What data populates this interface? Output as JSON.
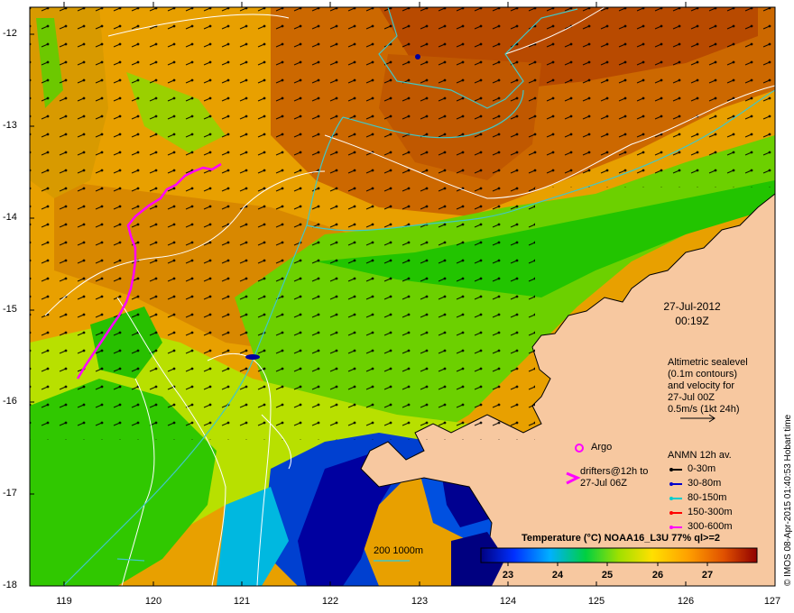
{
  "map": {
    "y_ticks": [
      "-12",
      "-13",
      "-14",
      "-15",
      "-16",
      "-17",
      "-18"
    ],
    "x_ticks": [
      "119",
      "120",
      "121",
      "122",
      "123",
      "124",
      "125",
      "126",
      "127"
    ],
    "date_line1": "27-Jul-2012",
    "date_line2": "00:19Z",
    "altimetry": {
      "line1": "Altimetric sealevel",
      "line2": "(0.1m contours)",
      "line3": "and velocity for",
      "line4": "27-Jul 00Z",
      "line5": "0.5m/s (1kt 24h)"
    },
    "argo_label": "Argo",
    "drifters_line1": "drifters@12h to",
    "drifters_line2": "27-Jul 06Z",
    "anmn_title": "ANMN 12h av.",
    "anmn_rows": [
      {
        "label": "0-30m",
        "color": "#000000"
      },
      {
        "label": "30-80m",
        "color": "#0000cc"
      },
      {
        "label": "80-150m",
        "color": "#00cccc"
      },
      {
        "label": "150-300m",
        "color": "#ff0000"
      },
      {
        "label": "300-600m",
        "color": "#ff00ff"
      }
    ],
    "contour_label": "200  1000m",
    "colorbar": {
      "title": "Temperature (°C) NOAA16_L3U 77% ql>=2",
      "ticks": [
        "23",
        "24",
        "25",
        "26",
        "27"
      ]
    },
    "credit": "© IMOS 08-Apr-2015 01:40:53 Hobart time",
    "colors": {
      "land": "#f7c8a0",
      "hot": "#c84e00",
      "warm": "#e8a000",
      "mid": "#e0d000",
      "cool": "#22cc00",
      "cold": "#0044cc",
      "coldest": "#000080",
      "drifter": "#ff00ff",
      "bathy": "#40c8c8"
    }
  }
}
